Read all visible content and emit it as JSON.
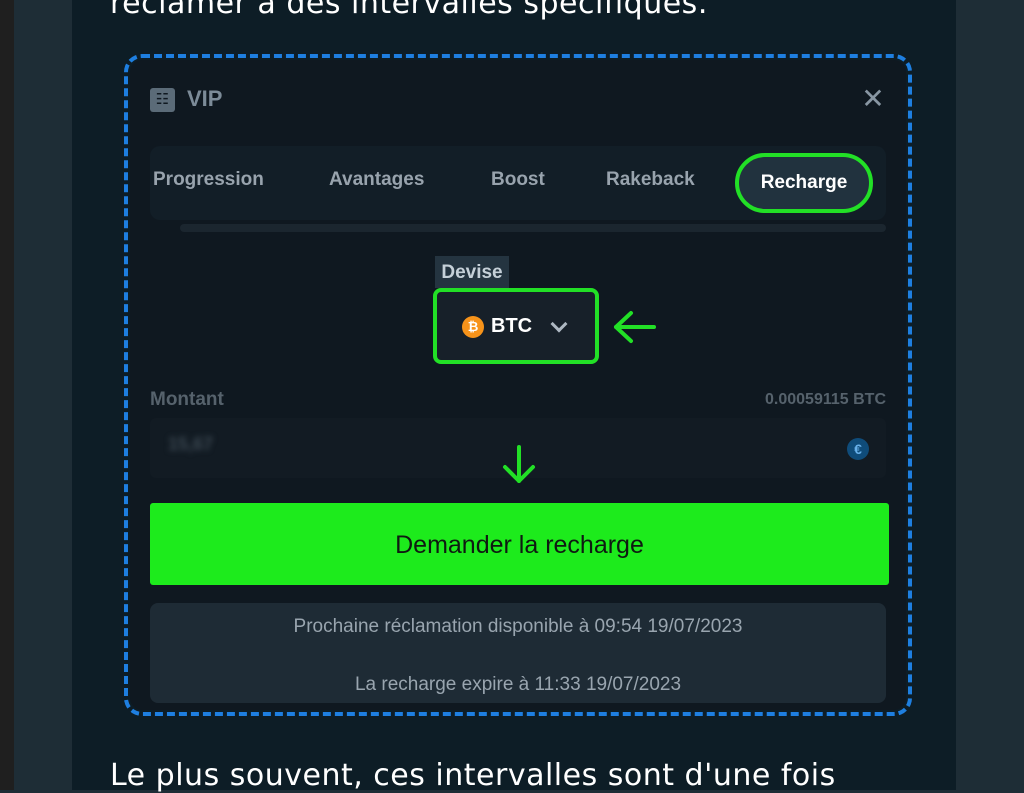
{
  "article": {
    "top_text": "réclamer à des intervalles spécifiques.",
    "bottom_text": "Le plus souvent, ces intervalles sont d'une fois"
  },
  "modal": {
    "title": "VIP",
    "close_glyph": "✕",
    "tabs": [
      {
        "label": "Progression"
      },
      {
        "label": "Avantages"
      },
      {
        "label": "Boost"
      },
      {
        "label": "Rakeback"
      },
      {
        "label": "Recharge",
        "active": true
      }
    ],
    "currency": {
      "label": "Devise",
      "selected": "BTC",
      "icon": "bitcoin-icon"
    },
    "amount": {
      "label": "Montant",
      "balance": "0.00059115 BTC",
      "value": "15,67",
      "currency_icon": "euro-icon"
    },
    "claim_button": "Demander la recharge",
    "next_claim": "Prochaine réclamation disponible à 09:54 19/07/2023",
    "expires": "La recharge expire à 11:33 19/07/2023"
  },
  "annotations": {
    "highlight_color": "#22e026",
    "frame_color": "#1e7fe0",
    "arrows": [
      "arrow-left-icon",
      "arrow-down-icon"
    ]
  },
  "colors": {
    "accent_green": "#1deb1c",
    "bitcoin": "#f7931a"
  }
}
